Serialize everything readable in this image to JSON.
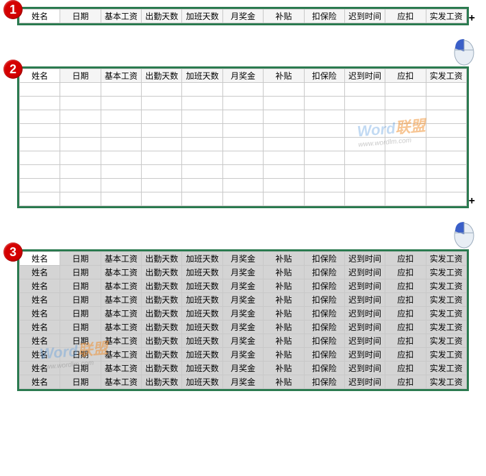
{
  "headers": [
    "姓名",
    "日期",
    "基本工资",
    "出勤天数",
    "加班天数",
    "月奖金",
    "补贴",
    "扣保险",
    "迟到时间",
    "应扣",
    "实发工资"
  ],
  "badges": {
    "s1": "1",
    "s2": "2",
    "s3": "3"
  },
  "step3_rows": 10,
  "watermark": {
    "main": "Word",
    "accent": "联盟",
    "sub": "www.wordlm.com"
  }
}
